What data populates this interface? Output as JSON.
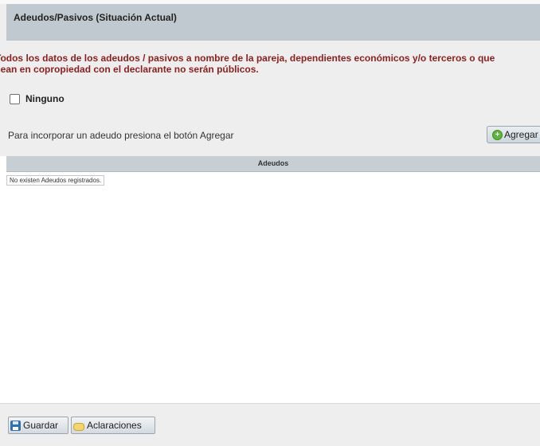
{
  "section": {
    "title": "Adeudos/Pasivos (Situación Actual)"
  },
  "notice": {
    "line1": "Todos los datos de los adeudos / pasivos a nombre de la pareja, dependientes económicos y/o terceros o que",
    "line2": "sean en copropiedad con el declarante no serán públicos."
  },
  "ninguno": {
    "label": "Ninguno",
    "checked": false
  },
  "add": {
    "hint": "Para incorporar un adeudo presiona el botón Agregar",
    "button_label": "Agregar"
  },
  "grid": {
    "header": "Adeudos",
    "empty_message": "No existen Adeudos registrados."
  },
  "footer": {
    "save_label": "Guardar",
    "clarifications_label": "Aclaraciones"
  },
  "colors": {
    "header_bg": "#bfc9cf",
    "notice_text": "#8e1f1f",
    "panel_bg": "#eeeeee",
    "add_icon": "#5cb536"
  },
  "icons": {
    "add": "plus-circle-icon",
    "save": "floppy-disk-icon",
    "clarifications": "speech-bubble-icon"
  }
}
